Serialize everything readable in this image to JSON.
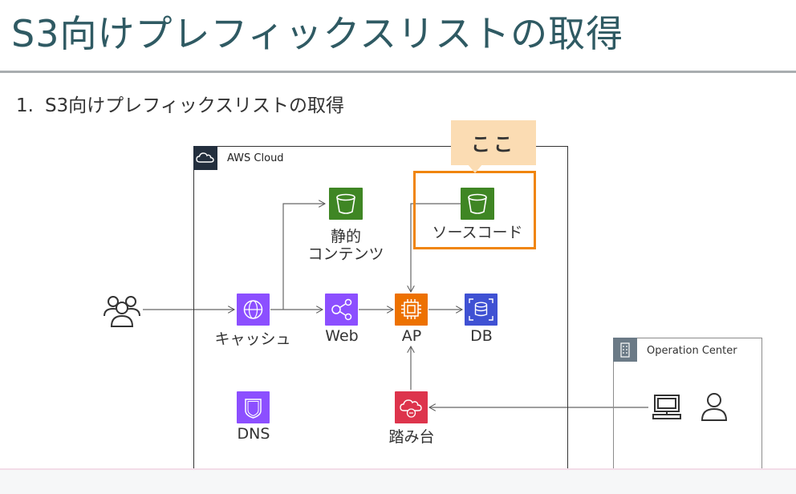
{
  "slide": {
    "title": "S3向けプレフィックスリストの取得",
    "bullet_number": "1.",
    "bullet_text": "S3向けプレフィックスリストの取得"
  },
  "diagram": {
    "aws_cloud_label": "AWS Cloud",
    "operation_center_label": "Operation Center",
    "callout_text": "ここ",
    "nodes": {
      "static_content": {
        "line1": "静的",
        "line2": "コンテンツ"
      },
      "source_code": "ソースコード",
      "cache": "キャッシュ",
      "web": "Web",
      "ap": "AP",
      "db": "DB",
      "dns": "DNS",
      "bastion": "踏み台"
    },
    "colors": {
      "s3": "#3f8624",
      "cloudfront": "#8c4fff",
      "ec2": "#ed7100",
      "rds": "#3f51d3",
      "security": "#dd344c",
      "highlight": "#f0850e",
      "callout": "#fbdcb3"
    },
    "icons": [
      "users-icon",
      "s3-bucket-icon",
      "cloudfront-icon",
      "ec2-icon",
      "rds-icon",
      "route53-icon",
      "bastion-icon",
      "desktop-icon",
      "user-icon",
      "cloud-icon",
      "building-icon"
    ]
  }
}
